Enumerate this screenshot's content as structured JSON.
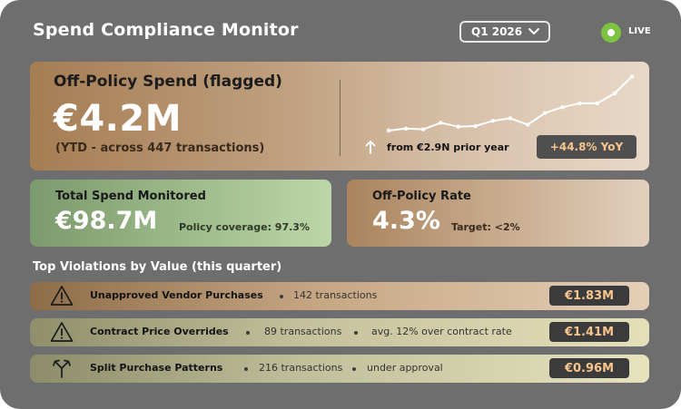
{
  "header": {
    "title": "Spend Compliance Monitor",
    "period": "Q1 2026",
    "live_label": "LIVE",
    "live_color": "#7dc242"
  },
  "hero": {
    "title": "Off-Policy Spend (flagged)",
    "value": "€4.2M",
    "subtitle": "(YTD - across 447 transactions)",
    "prior": "from €2.9N prior year",
    "yoy": "+44.8% YoY",
    "trend_values": [
      0.0,
      0.03,
      0.02,
      0.12,
      0.06,
      0.07,
      0.15,
      0.19,
      0.09,
      0.27,
      0.36,
      0.42,
      0.42,
      0.57,
      0.83
    ]
  },
  "cards": {
    "total": {
      "title": "Total Spend Monitored",
      "value": "€98.7M",
      "note": "Policy coverage: 97.3%"
    },
    "rate": {
      "title": "Off-Policy Rate",
      "value": "4.3%",
      "note": "Target: <2%"
    }
  },
  "violations": {
    "title": "Top Violations by Value (this quarter)",
    "items": [
      {
        "icon": "warning-icon",
        "name": "Unapproved Vendor Purchases",
        "meta1": "142 transactions",
        "meta2": "",
        "amount": "€1.83M"
      },
      {
        "icon": "warning-icon",
        "name": "Contract Price Overrides",
        "meta1": "89 transactions",
        "meta2": "avg. 12% over contract rate",
        "amount": "€1.41M"
      },
      {
        "icon": "split-arrow-icon",
        "name": "Split Purchase Patterns",
        "meta1": "216 transactions",
        "meta2": "under approval",
        "amount": "€0.96M"
      }
    ]
  },
  "colors": {
    "background": "#6e6e6e",
    "accent_amount": "#f7c58e"
  }
}
